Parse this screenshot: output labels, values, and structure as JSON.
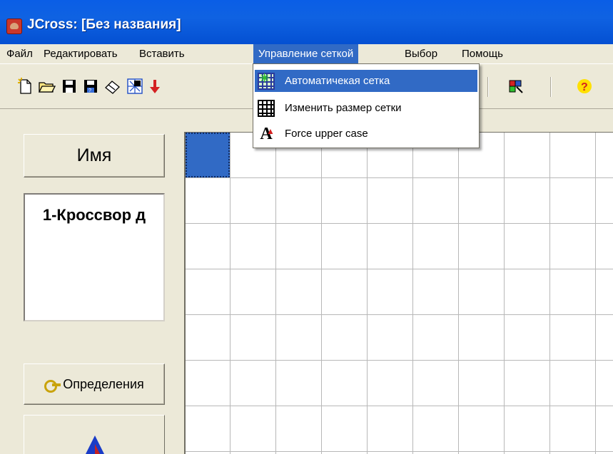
{
  "window": {
    "title": "JCross: [Без названия]"
  },
  "menu": {
    "items": [
      "Файл",
      "Редактировать",
      "Вставить",
      "Управление сеткой",
      "Выбор",
      "Помощь"
    ],
    "open_index": 3
  },
  "dropdown": {
    "items": [
      {
        "label": "Автоматичекая сетка",
        "icon": "auto-grid-icon",
        "highlighted": true
      },
      {
        "label": "Изменить размер сетки",
        "icon": "grid-resize-icon"
      },
      {
        "label": "Force upper case",
        "icon": "upper-case-icon"
      }
    ]
  },
  "toolbar": {
    "buttons": [
      "new-file-icon",
      "open-folder-icon",
      "save-icon",
      "save-as-icon",
      "eraser-icon",
      "web-icon",
      "arrow-down-icon",
      "colors-icon",
      "help-icon"
    ]
  },
  "left_panel": {
    "name_button": "Имя",
    "name_value": "1-Кроссвор д",
    "definitions_button": "Определения"
  },
  "colors": {
    "titlebar": "#0a5ee6",
    "selection": "#316ac5",
    "face": "#ece9d8"
  }
}
